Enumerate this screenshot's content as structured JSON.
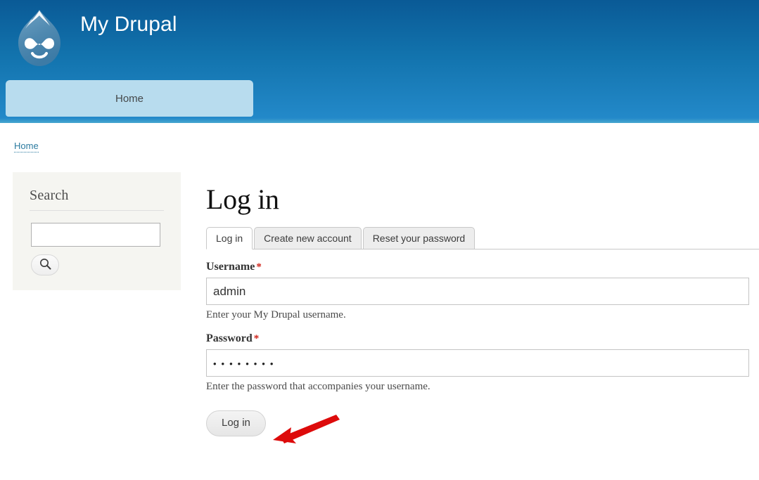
{
  "header": {
    "site_title": "My Drupal",
    "logo_icon": "drupal-droplet-icon",
    "menu": [
      {
        "label": "Home",
        "active": true
      }
    ]
  },
  "breadcrumb": {
    "items": [
      {
        "label": "Home"
      }
    ]
  },
  "sidebar": {
    "search_block": {
      "title": "Search",
      "input_value": "",
      "input_placeholder": "",
      "submit_icon": "search-icon"
    }
  },
  "main": {
    "page_title": "Log in",
    "tabs": [
      {
        "label": "Log in",
        "active": true
      },
      {
        "label": "Create new account",
        "active": false
      },
      {
        "label": "Reset your password",
        "active": false
      }
    ],
    "form": {
      "username": {
        "label": "Username",
        "required_marker": "*",
        "value": "admin",
        "placeholder": "",
        "description": "Enter your My Drupal username."
      },
      "password": {
        "label": "Password",
        "required_marker": "*",
        "value": "••••••••",
        "masked_value": "• • • • • • • •",
        "placeholder": "",
        "description": "Enter the password that accompanies your username."
      },
      "submit_label": "Log in"
    }
  },
  "annotation": {
    "arrow_color": "#dd0b0b",
    "arrow_points_to": "log-in-button"
  },
  "colors": {
    "header_gradient_top": "#0a5a96",
    "header_gradient_bottom": "#2389c9",
    "menu_tab_bg": "#b8dcee",
    "sidebar_bg": "#f5f5f1",
    "link_blue": "#2c7ba0",
    "required_red": "#d0241b"
  }
}
